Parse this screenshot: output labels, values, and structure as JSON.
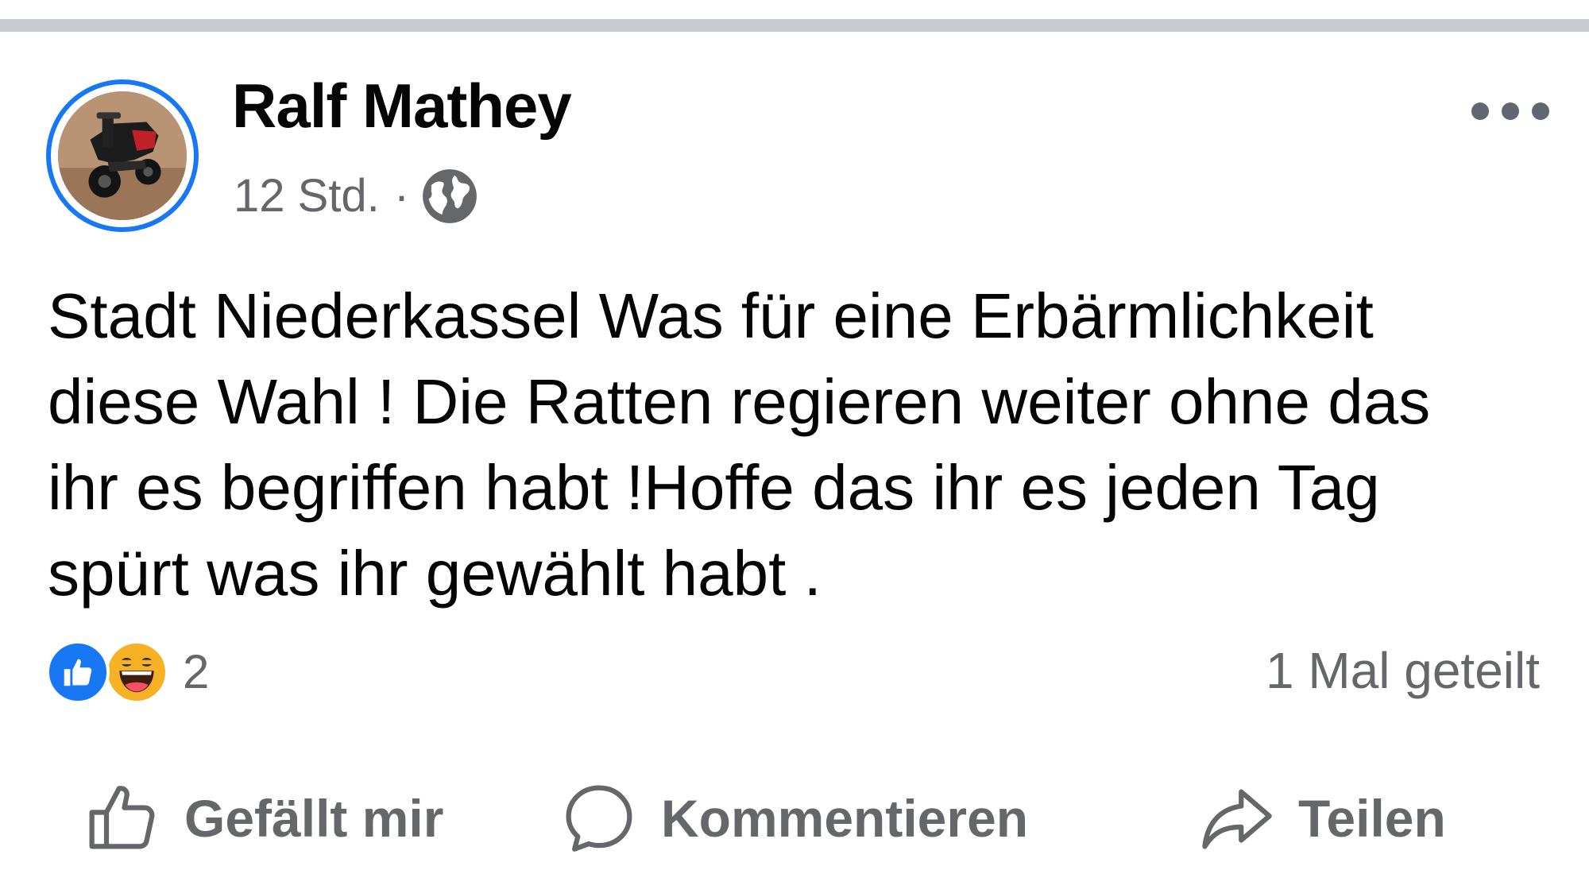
{
  "post": {
    "author": "Ralf Mathey",
    "time": "12 Std.",
    "separator": "·",
    "audience_icon": "globe-icon",
    "text_lines": [
      "Stadt Niederkassel Was für eine Erbärmlichkeit",
      "diese Wahl ! Die Ratten regieren weiter ohne das",
      "ihr es begriffen habt !Hoffe das ihr es jeden Tag",
      "spürt was ihr gewählt habt ."
    ],
    "reactions": {
      "types": [
        "like",
        "haha"
      ],
      "count": "2"
    },
    "shares": "1 Mal geteilt"
  },
  "actions": {
    "like_label": "Gefällt mir",
    "comment_label": "Kommentieren",
    "share_label": "Teilen"
  },
  "colors": {
    "accent": "#1877f2",
    "secondary_text": "#65676b",
    "haha": "#f7b125",
    "divider": "#c9ccd1"
  }
}
